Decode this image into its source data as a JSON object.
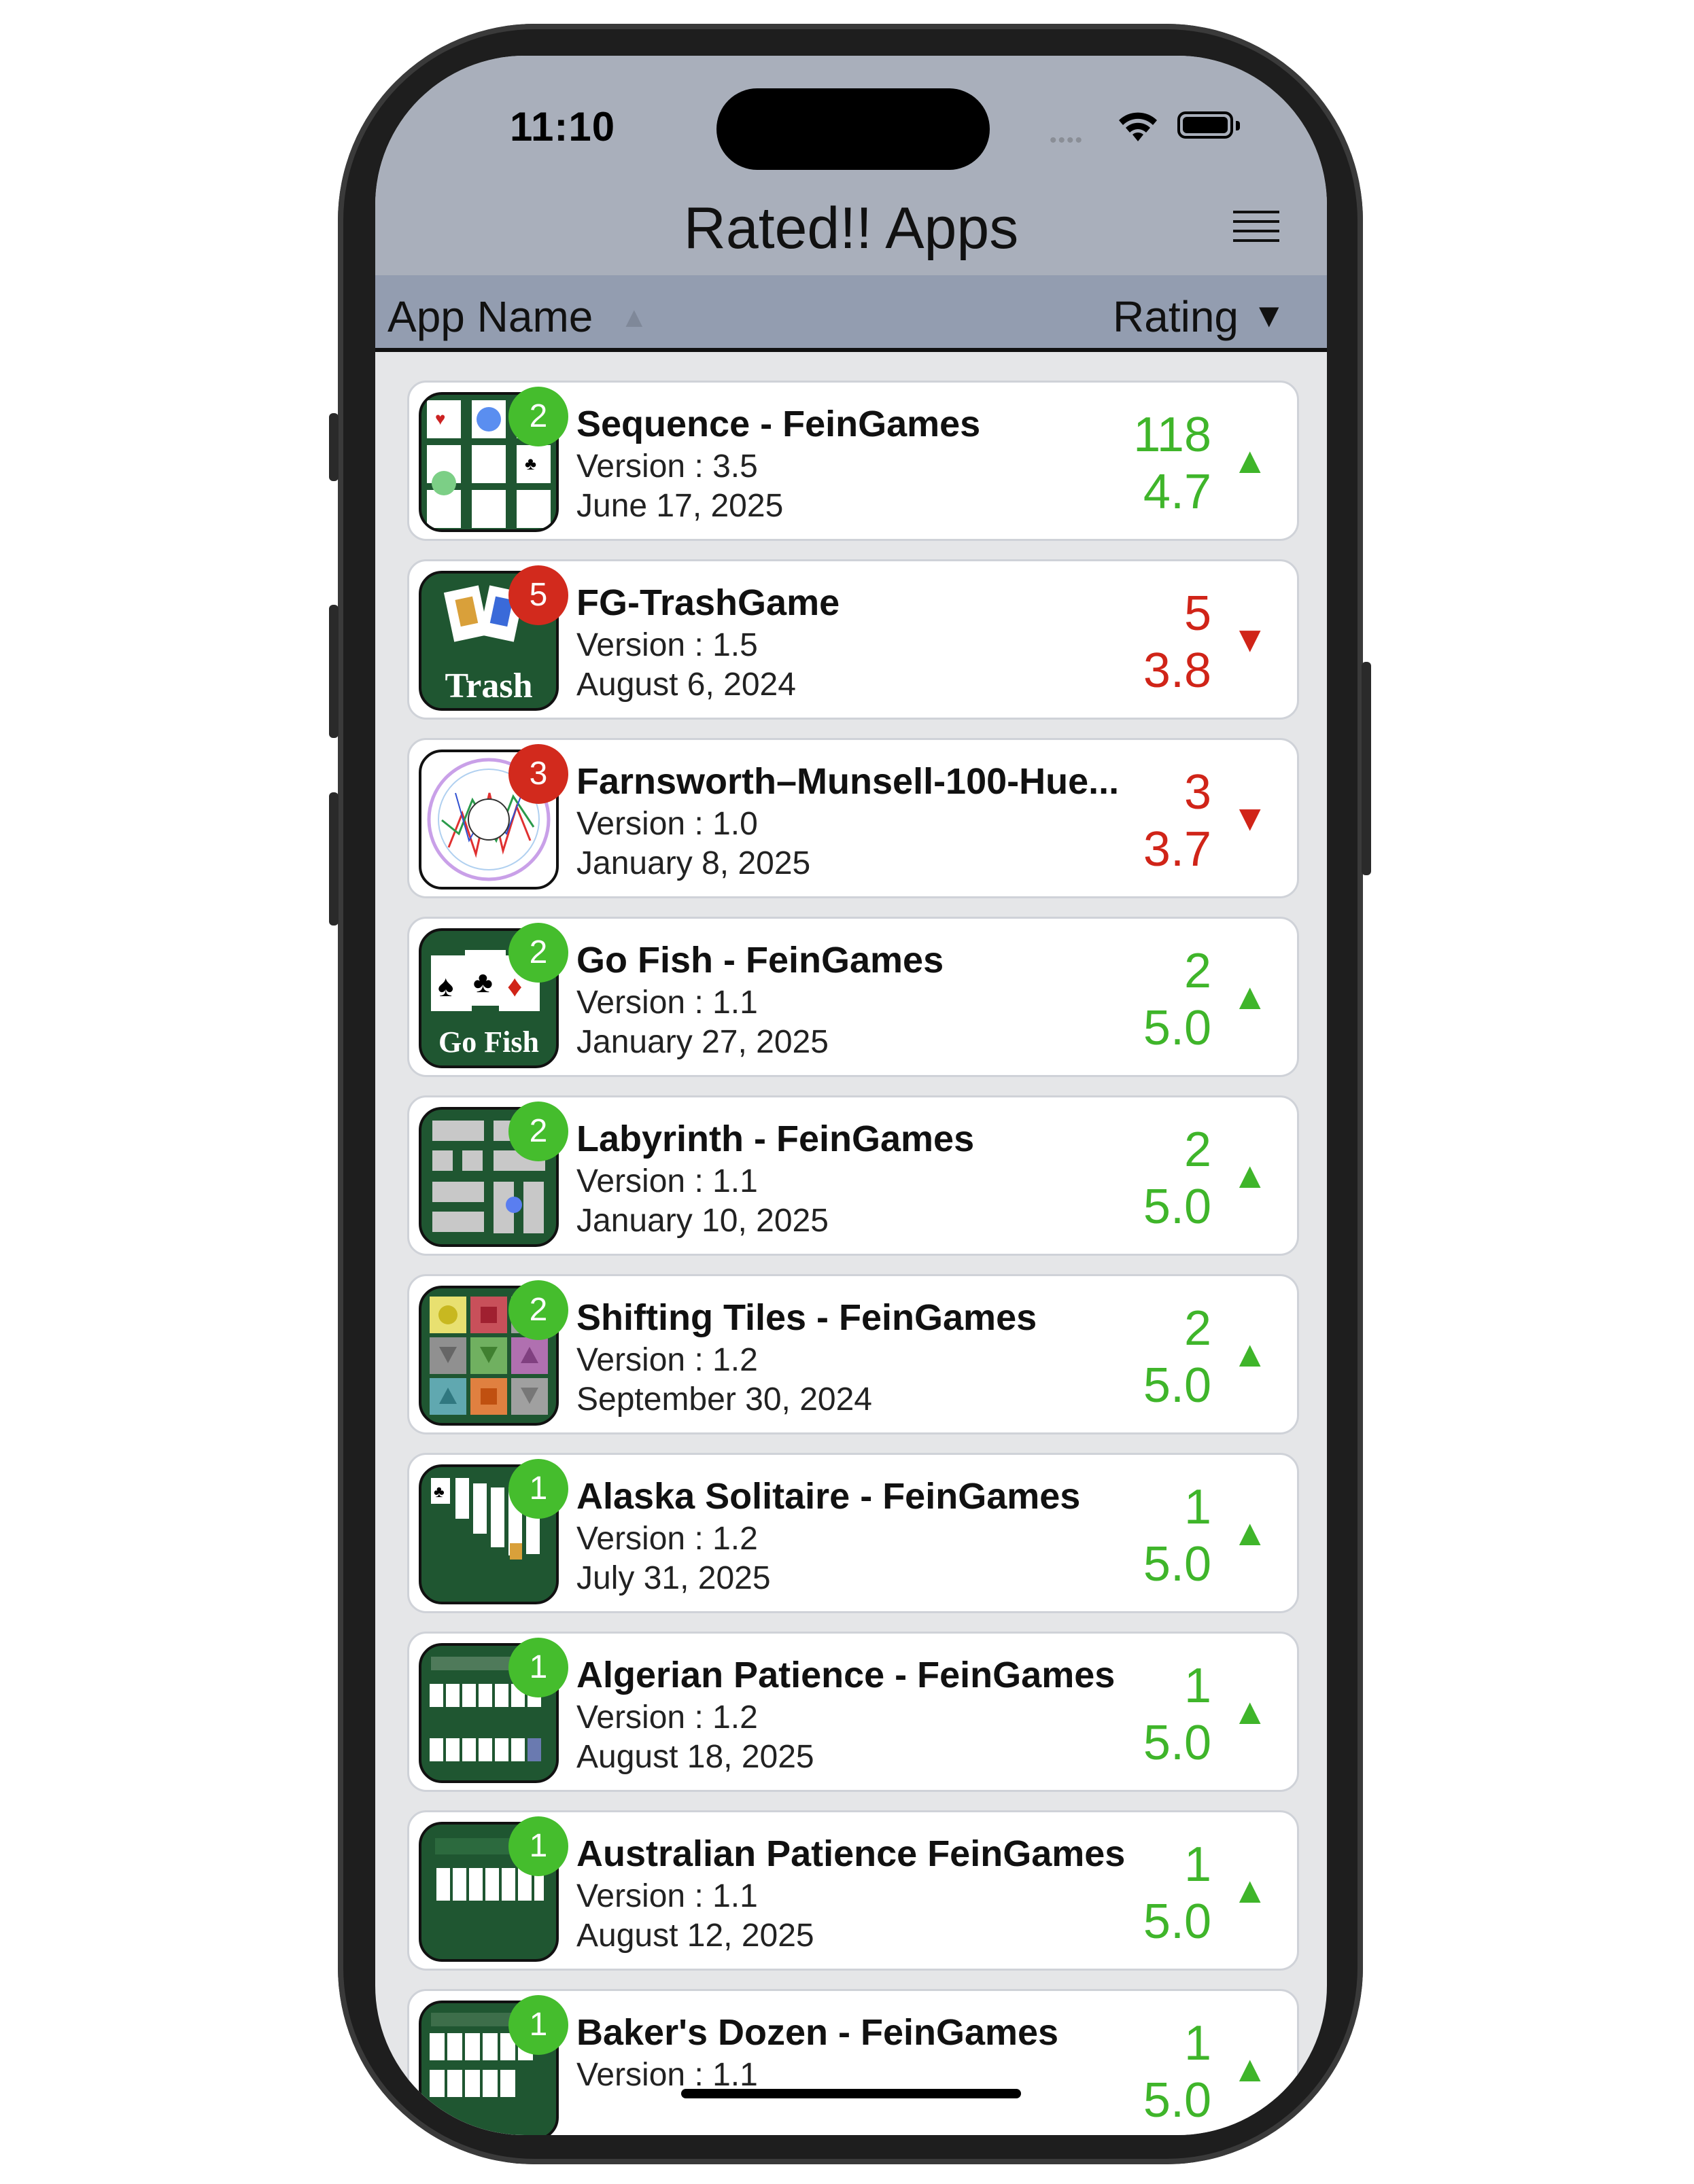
{
  "status_bar": {
    "time": "11:10",
    "signal_dots": "•••• "
  },
  "header": {
    "title": "Rated!! Apps",
    "menu_icon": "hamburger-menu-icon"
  },
  "sort_bar": {
    "name_label": "App Name",
    "name_arrow": "▲",
    "rating_label": "Rating",
    "rating_arrow": "▼"
  },
  "colors": {
    "up": "#3fb52a",
    "down": "#d02418",
    "badge_green": "#45bd2d",
    "badge_red": "#d22a1d"
  },
  "apps": [
    {
      "name": "Sequence - FeinGames",
      "version": "Version : 3.5",
      "date": "June 17, 2025",
      "count": "118",
      "avg": "4.7",
      "badge": "2",
      "trend": "up",
      "arrow": "▲",
      "icon": "sequence-icon"
    },
    {
      "name": "FG-TrashGame",
      "version": "Version : 1.5",
      "date": "August 6, 2024",
      "count": "5",
      "avg": "3.8",
      "badge": "5",
      "trend": "down",
      "arrow": "▼",
      "icon": "trash-game-icon",
      "icon_label": "Trash"
    },
    {
      "name": "Farnsworth–Munsell-100-Hue...",
      "version": "Version : 1.0",
      "date": "January 8, 2025",
      "count": "3",
      "avg": "3.7",
      "badge": "3",
      "trend": "down",
      "arrow": "▼",
      "icon": "hue-test-icon"
    },
    {
      "name": "Go Fish - FeinGames",
      "version": "Version : 1.1",
      "date": "January 27, 2025",
      "count": "2",
      "avg": "5.0",
      "badge": "2",
      "trend": "up",
      "arrow": "▲",
      "icon": "go-fish-icon",
      "icon_label": "Go Fish"
    },
    {
      "name": "Labyrinth - FeinGames",
      "version": "Version : 1.1",
      "date": "January 10, 2025",
      "count": "2",
      "avg": "5.0",
      "badge": "2",
      "trend": "up",
      "arrow": "▲",
      "icon": "labyrinth-icon"
    },
    {
      "name": "Shifting Tiles - FeinGames",
      "version": "Version : 1.2",
      "date": "September 30, 2024",
      "count": "2",
      "avg": "5.0",
      "badge": "2",
      "trend": "up",
      "arrow": "▲",
      "icon": "shifting-tiles-icon"
    },
    {
      "name": "Alaska Solitaire - FeinGames",
      "version": "Version : 1.2",
      "date": "July 31, 2025",
      "count": "1",
      "avg": "5.0",
      "badge": "1",
      "trend": "up",
      "arrow": "▲",
      "icon": "alaska-solitaire-icon"
    },
    {
      "name": "Algerian Patience - FeinGames",
      "version": "Version : 1.2",
      "date": "August 18, 2025",
      "count": "1",
      "avg": "5.0",
      "badge": "1",
      "trend": "up",
      "arrow": "▲",
      "icon": "algerian-patience-icon"
    },
    {
      "name": "Australian Patience FeinGames",
      "version": "Version : 1.1",
      "date": "August 12, 2025",
      "count": "1",
      "avg": "5.0",
      "badge": "1",
      "trend": "up",
      "arrow": "▲",
      "icon": "australian-patience-icon"
    },
    {
      "name": "Baker's Dozen - FeinGames",
      "version": "Version : 1.1",
      "date": "",
      "count": "1",
      "avg": "5.0",
      "badge": "1",
      "trend": "up",
      "arrow": "▲",
      "icon": "bakers-dozen-icon"
    }
  ]
}
